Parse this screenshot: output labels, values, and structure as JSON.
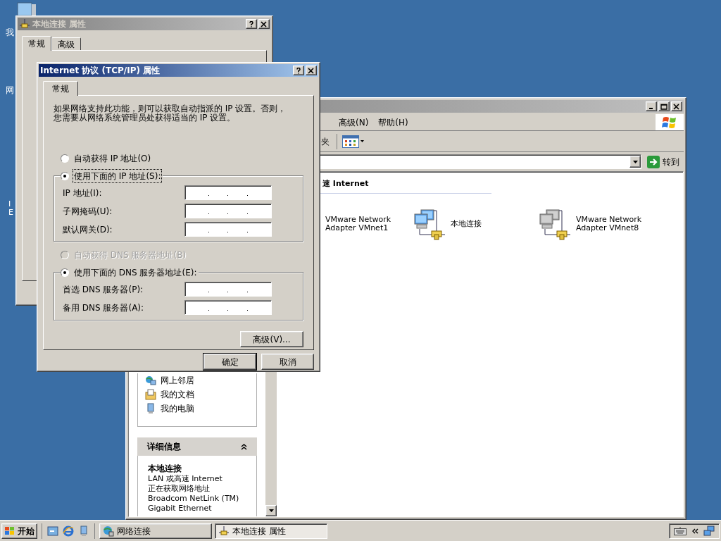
{
  "desktop_icons": [
    {
      "lines": [
        "我"
      ]
    },
    {
      "lines": [
        "网"
      ]
    },
    {
      "lines": [
        "I",
        "E"
      ]
    }
  ],
  "explorer_window": {
    "active": false,
    "menu": [
      {
        "label": "高级(N)"
      },
      {
        "label": "帮助(H)"
      }
    ],
    "toolbar_label": "夹",
    "go_button": "转到",
    "other_places": [
      {
        "label": "网上邻居",
        "kind": "network"
      },
      {
        "label": "我的文档",
        "kind": "documents"
      },
      {
        "label": "我的电脑",
        "kind": "computer"
      }
    ],
    "details": {
      "title": "详细信息",
      "expanded": true,
      "name": "本地连接",
      "lines": [
        "LAN 或高速 Internet",
        "正在获取网络地址",
        "Broadcom NetLink (TM)",
        "Gigabit Ethernet"
      ]
    },
    "group_header": "速 Internet",
    "connections": [
      {
        "lines": [
          "VMware Network",
          "Adapter VMnet1"
        ]
      },
      {
        "lines": [
          "本地连接"
        ],
        "icon": true,
        "disabled": false
      },
      {
        "lines": [
          "VMware Network",
          "Adapter VMnet8"
        ],
        "icon": true,
        "disabled": true
      }
    ]
  },
  "connection_properties": {
    "title": "本地连接 属性",
    "active": false,
    "tabs": [
      {
        "label": "常规",
        "selected": true
      },
      {
        "label": "高级",
        "selected": false
      }
    ]
  },
  "tcpip_dialog": {
    "title": "Internet 协议 (TCP/IP) 属性",
    "active": true,
    "tabs": [
      {
        "label": "常规",
        "selected": true
      }
    ],
    "description": "如果网络支持此功能，则可以获取自动指派的 IP 设置。否则，您需要从网络系统管理员处获得适当的 IP 设置。",
    "ip_options": [
      {
        "label": "自动获得 IP 地址(O)",
        "selected": false,
        "disabled": false,
        "focused": false
      },
      {
        "label": "使用下面的 IP 地址(S):",
        "selected": true,
        "disabled": false,
        "focused": true
      }
    ],
    "ip_fields": [
      {
        "label": "IP 地址(I):"
      },
      {
        "label": "子网掩码(U):"
      },
      {
        "label": "默认网关(D):"
      }
    ],
    "dns_options": [
      {
        "label": "自动获得 DNS 服务器地址(B)",
        "selected": false,
        "disabled": true,
        "focused": false
      },
      {
        "label": "使用下面的 DNS 服务器地址(E):",
        "selected": true,
        "disabled": false,
        "focused": false
      }
    ],
    "dns_fields": [
      {
        "label": "首选 DNS 服务器(P):"
      },
      {
        "label": "备用 DNS 服务器(A):"
      }
    ],
    "advanced_button": "高级(V)...",
    "buttons": [
      {
        "label": "确定",
        "default": true
      },
      {
        "label": "取消",
        "default": false
      }
    ]
  },
  "taskbar": {
    "start": "开始",
    "tasks": [
      {
        "label": "网络连接",
        "selected": false,
        "kind": "network"
      },
      {
        "label": "本地连接 属性",
        "selected": true,
        "kind": "connection"
      }
    ]
  }
}
